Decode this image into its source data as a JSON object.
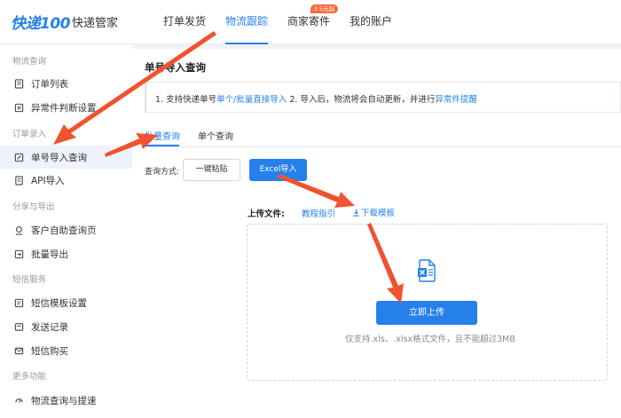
{
  "header": {
    "logo": "快递100",
    "brand_sub": "快递管家",
    "nav": [
      {
        "label": "打单发货"
      },
      {
        "label": "物流跟踪"
      },
      {
        "label": "商家寄件",
        "badge": "3.5元起"
      },
      {
        "label": "我的账户"
      }
    ]
  },
  "sidebar": {
    "sections": [
      {
        "title": "物流查询",
        "items": [
          {
            "label": "订单列表",
            "icon": "list-icon"
          },
          {
            "label": "异常件判断设置",
            "icon": "settings-icon"
          }
        ]
      },
      {
        "title": "订单录入",
        "items": [
          {
            "label": "单号导入查询",
            "icon": "edit-icon"
          },
          {
            "label": "API导入",
            "icon": "api-icon"
          }
        ]
      },
      {
        "title": "分享与导出",
        "items": [
          {
            "label": "客户自助查询页",
            "icon": "location-icon"
          },
          {
            "label": "批量导出",
            "icon": "export-icon"
          }
        ]
      },
      {
        "title": "短信服务",
        "items": [
          {
            "label": "短信模板设置",
            "icon": "template-icon"
          },
          {
            "label": "发送记录",
            "icon": "send-icon"
          },
          {
            "label": "短信购买",
            "icon": "mail-icon"
          }
        ]
      },
      {
        "title": "更多功能",
        "items": [
          {
            "label": "物流查询与提速",
            "icon": "speed-icon"
          }
        ]
      }
    ]
  },
  "main": {
    "title": "单号导入查询",
    "notice": {
      "part1": "1. 支持快递单号",
      "link1": "单个/批量直接导入",
      "part2": "2. 导入后，物流将会自动更新，并进行",
      "link2": "异常件提醒"
    },
    "tabs": [
      {
        "label": "批量查询"
      },
      {
        "label": "单个查询"
      }
    ],
    "method_label": "查询方式:",
    "paste_button": "一键粘贴",
    "excel_button": "Excel导入",
    "upload_label": "上传文件:",
    "guide_link": "教程指引",
    "download_link": "下载模板",
    "upload_button": "立即上传",
    "upload_hint": "仅支持.xls、.xlsx格式文件，且不能超过3MB"
  },
  "colors": {
    "accent": "#2680eb",
    "annotation_arrow": "#f0532f",
    "badge": "#ff6a3d"
  }
}
